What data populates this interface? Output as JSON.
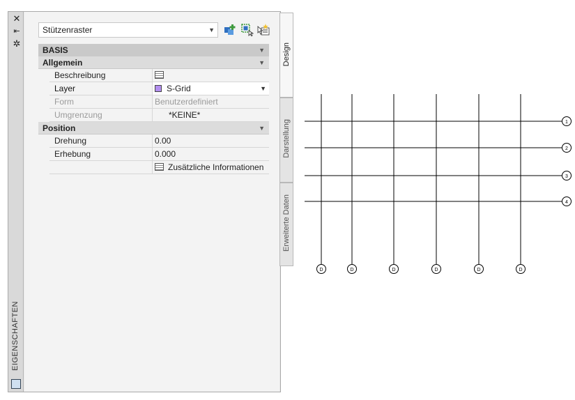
{
  "palette": {
    "title": "EIGENSCHAFTEN",
    "selector_value": "Stützenraster",
    "tabs": [
      "Design",
      "Darstellung",
      "Erweiterte Daten"
    ]
  },
  "properties": {
    "basis_label": "BASIS",
    "allgemein_label": "Allgemein",
    "rows_allgemein": [
      {
        "key": "Beschreibung",
        "value": ""
      },
      {
        "key": "Layer",
        "value": "S-Grid"
      },
      {
        "key": "Form",
        "value": "Benutzerdefiniert"
      },
      {
        "key": "Umgrenzung",
        "value": "*KEINE*"
      }
    ],
    "position_label": "Position",
    "rows_position": [
      {
        "key": "Drehung",
        "value": "0.00"
      },
      {
        "key": "Erhebung",
        "value": "0.000"
      },
      {
        "key": "",
        "value": "Zusätzliche Informationen"
      }
    ]
  },
  "drawing": {
    "column_bubbles": [
      "D",
      "D",
      "D",
      "D",
      "D",
      "D"
    ],
    "row_bubbles": [
      "1",
      "2",
      "3",
      "4"
    ]
  },
  "colors": {
    "layer_swatch": "#b38ef0",
    "tool_green": "#3f9a3f",
    "tool_blue": "#2f6fc0"
  }
}
